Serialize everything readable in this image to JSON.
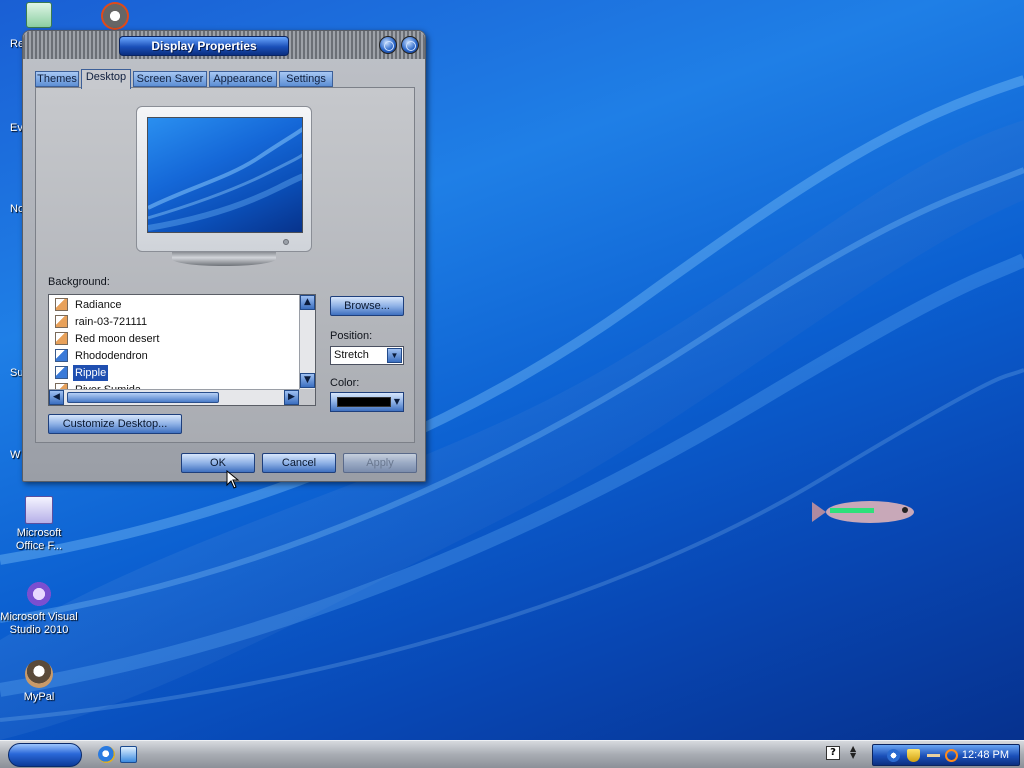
{
  "desktop": {
    "edge_labels": [
      "Re",
      "Ev",
      "No",
      "Su",
      "W"
    ],
    "icons": [
      {
        "label_line1": "Microsoft",
        "label_line2": "Office F...",
        "icon": "office-icon"
      },
      {
        "label_line1": "Microsoft Visual",
        "label_line2": "Studio 2010",
        "icon": "visual-studio-icon"
      },
      {
        "label_line1": "MyPal",
        "label_line2": "",
        "icon": "mypal-icon"
      }
    ]
  },
  "dialog": {
    "title": "Display Properties",
    "tabs": [
      "Themes",
      "Desktop",
      "Screen Saver",
      "Appearance",
      "Settings"
    ],
    "active_tab": "Desktop",
    "background_label": "Background:",
    "background_items": [
      {
        "name": "Radiance",
        "icon": "image-file-icon"
      },
      {
        "name": "rain-03-721111",
        "icon": "image-file-icon"
      },
      {
        "name": "Red moon desert",
        "icon": "image-file-icon"
      },
      {
        "name": "Rhododendron",
        "icon": "image-file-icon"
      },
      {
        "name": "Ripple",
        "icon": "image-file-icon",
        "selected": true
      },
      {
        "name": "River Sumida",
        "icon": "image-file-icon"
      }
    ],
    "browse_label": "Browse...",
    "position_label": "Position:",
    "position_value": "Stretch",
    "color_label": "Color:",
    "color_value": "#000000",
    "customize_label": "Customize Desktop...",
    "ok_label": "OK",
    "cancel_label": "Cancel",
    "apply_label": "Apply"
  },
  "taskbar": {
    "clock": "12:48 PM"
  },
  "colors": {
    "accent": "#1f4fb0",
    "desktop_blue": "#0b5fd0"
  }
}
